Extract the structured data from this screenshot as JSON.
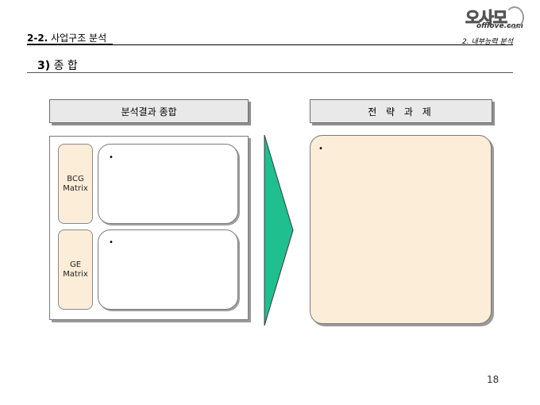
{
  "header": {
    "section_number": "2-2.",
    "section_title": "사업구조 분석",
    "chapter": "2. 내부능력 분석",
    "logo_main": "오사모",
    "logo_sub": "offlove.com"
  },
  "page_heading": {
    "number": "3)",
    "title": "종 합"
  },
  "left_column": {
    "header": "분석결과 종합",
    "rows": [
      {
        "label_line1": "BCG",
        "label_line2": "Matrix",
        "bullet": "•"
      },
      {
        "label_line1": "GE",
        "label_line2": "Matrix",
        "bullet": "•"
      }
    ]
  },
  "right_column": {
    "header": "전 략 과 제",
    "bullet": "•"
  },
  "colors": {
    "arrow_fill": "#1fbf8f",
    "label_fill": "#fcedd9",
    "header_fill": "#e9e9e9"
  },
  "page_number": "18"
}
